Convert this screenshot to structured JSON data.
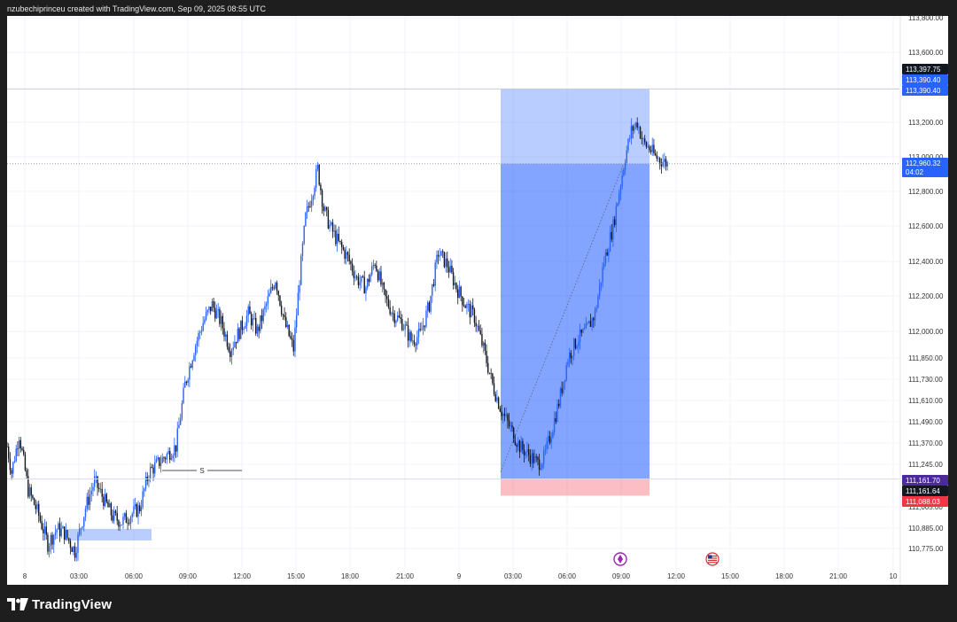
{
  "header": {
    "text": "nzubechiprinceu created with TradingView.com, Sep 09, 2025 08:55 UTC"
  },
  "footer": {
    "brand": "TradingView",
    "logo_icon": "tradingview-logo-icon"
  },
  "colors": {
    "up": "#2962ff",
    "down": "#131722",
    "profit_zone": "#2962ff",
    "stop_zone": "#f23645",
    "tag_dark": "#131722",
    "tag_blue": "#2962ff",
    "tag_purple": "#4a2a9c",
    "tag_red": "#f23645"
  },
  "chart_data": {
    "type": "candlestick",
    "symbol_interval": "5m",
    "grid": true,
    "y_axis": {
      "position": "right",
      "ticks": [
        "113,800.00",
        "113,600.00",
        "113,200.00",
        "113,000.00",
        "112,800.00",
        "112,600.00",
        "112,400.00",
        "112,200.00",
        "112,000.00",
        "111,850.00",
        "111,730.00",
        "111,610.00",
        "111,490.00",
        "111,370.00",
        "111,245.00",
        "111,005.00",
        "110,885.00",
        "110,775.00"
      ]
    },
    "x_axis": {
      "ticks": [
        "8",
        "03:00",
        "06:00",
        "09:00",
        "12:00",
        "15:00",
        "18:00",
        "21:00",
        "9",
        "03:00",
        "06:00",
        "09:00",
        "12:00",
        "15:00",
        "18:00",
        "21:00",
        "10"
      ]
    },
    "price_tags": [
      {
        "label": "113,397.75",
        "style": "dark"
      },
      {
        "label": "113,390.40",
        "style": "blue"
      },
      {
        "label": "113,390.40",
        "style": "blue"
      },
      {
        "label": "112,960.32",
        "sub": "04:02",
        "style": "blue"
      },
      {
        "label": "111,161.70",
        "style": "purple"
      },
      {
        "label": "111,161.64",
        "style": "dark"
      },
      {
        "label": "111,088.03",
        "style": "red"
      }
    ],
    "position": {
      "type": "long",
      "entry": 111161.7,
      "target": 113390.4,
      "stop": 111088.03,
      "current": 112960.32
    },
    "annotations": [
      {
        "type": "horizontal-segment",
        "label": "S"
      },
      {
        "type": "zone",
        "name": "demand-zone"
      }
    ],
    "events": [
      {
        "name": "ethereum-event-icon"
      },
      {
        "name": "us-flag-event-icon"
      }
    ],
    "series_path": [
      [
        0,
        111350
      ],
      [
        3,
        111200
      ],
      [
        8,
        111420
      ],
      [
        14,
        111100
      ],
      [
        20,
        110980
      ],
      [
        27,
        110800
      ],
      [
        33,
        110880
      ],
      [
        38,
        110860
      ],
      [
        45,
        110760
      ],
      [
        52,
        111000
      ],
      [
        58,
        111150
      ],
      [
        64,
        111050
      ],
      [
        70,
        110950
      ],
      [
        76,
        110920
      ],
      [
        82,
        110960
      ],
      [
        88,
        111000
      ],
      [
        94,
        111200
      ],
      [
        100,
        111250
      ],
      [
        106,
        111300
      ],
      [
        112,
        111350
      ],
      [
        118,
        111700
      ],
      [
        124,
        111900
      ],
      [
        130,
        112050
      ],
      [
        136,
        112150
      ],
      [
        142,
        112050
      ],
      [
        148,
        111900
      ],
      [
        154,
        112000
      ],
      [
        160,
        112100
      ],
      [
        166,
        112000
      ],
      [
        172,
        112150
      ],
      [
        178,
        112300
      ],
      [
        184,
        112050
      ],
      [
        190,
        111900
      ],
      [
        194,
        112300
      ],
      [
        198,
        112650
      ],
      [
        202,
        112780
      ],
      [
        206,
        112930
      ],
      [
        210,
        112700
      ],
      [
        214,
        112600
      ],
      [
        220,
        112500
      ],
      [
        226,
        112420
      ],
      [
        232,
        112300
      ],
      [
        238,
        112250
      ],
      [
        244,
        112400
      ],
      [
        250,
        112200
      ],
      [
        256,
        112100
      ],
      [
        262,
        112050
      ],
      [
        268,
        111950
      ],
      [
        274,
        111980
      ],
      [
        280,
        112150
      ],
      [
        286,
        112450
      ],
      [
        292,
        112380
      ],
      [
        298,
        112250
      ],
      [
        304,
        112150
      ],
      [
        310,
        112080
      ],
      [
        316,
        111900
      ],
      [
        322,
        111700
      ],
      [
        328,
        111550
      ],
      [
        334,
        111450
      ],
      [
        340,
        111350
      ],
      [
        346,
        111300
      ],
      [
        352,
        111250
      ],
      [
        356,
        111280
      ],
      [
        360,
        111400
      ],
      [
        366,
        111600
      ],
      [
        372,
        111850
      ],
      [
        378,
        111950
      ],
      [
        384,
        112000
      ],
      [
        390,
        112100
      ],
      [
        396,
        112400
      ],
      [
        402,
        112600
      ],
      [
        406,
        112800
      ],
      [
        410,
        113000
      ],
      [
        414,
        113150
      ],
      [
        418,
        113200
      ],
      [
        422,
        113080
      ],
      [
        426,
        113050
      ],
      [
        430,
        113000
      ],
      [
        434,
        112980
      ],
      [
        438,
        112960
      ]
    ]
  }
}
